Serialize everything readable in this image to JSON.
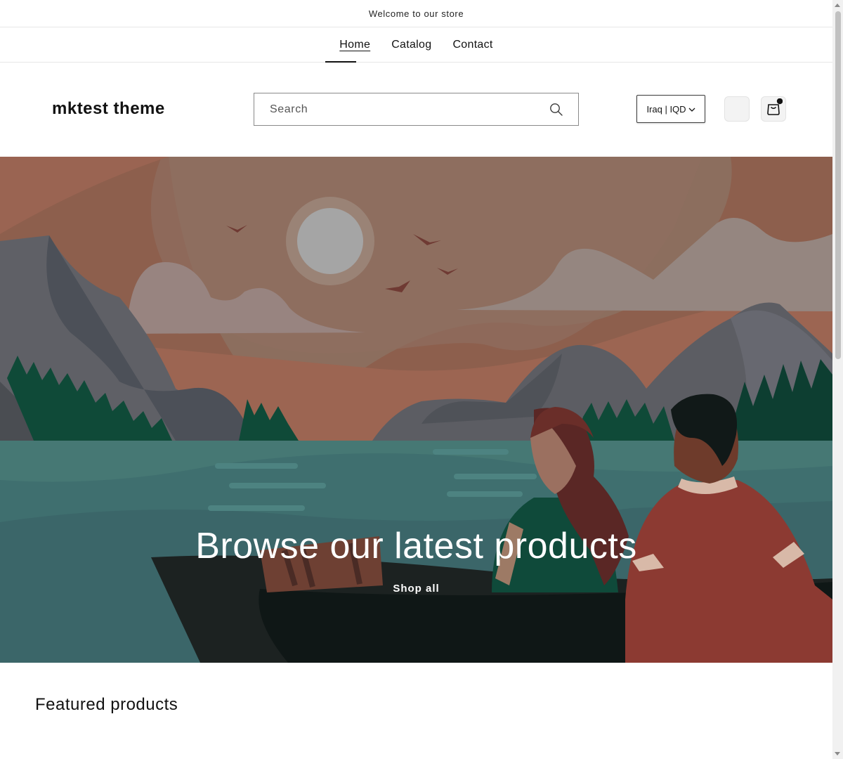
{
  "announcement": {
    "text": "Welcome to our store"
  },
  "nav": {
    "items": [
      {
        "label": "Home",
        "active": true
      },
      {
        "label": "Catalog",
        "active": false
      },
      {
        "label": "Contact",
        "active": false
      }
    ]
  },
  "header": {
    "logo": "mktest theme",
    "search": {
      "placeholder": "Search",
      "icon": "search-icon"
    },
    "country_selector": {
      "label": "Iraq | IQD",
      "icon": "chevron-down-icon"
    },
    "account_icon": "account-icon",
    "cart_icon": "cart-icon"
  },
  "hero": {
    "heading": "Browse our latest products",
    "button_label": "Shop all"
  },
  "featured": {
    "title": "Featured products"
  },
  "colors": {
    "sky": "#8c6e5e",
    "water": "#3f6f6f",
    "forest": "#0f3b30",
    "text_light": "#ffffff",
    "text_dark": "#121212"
  }
}
